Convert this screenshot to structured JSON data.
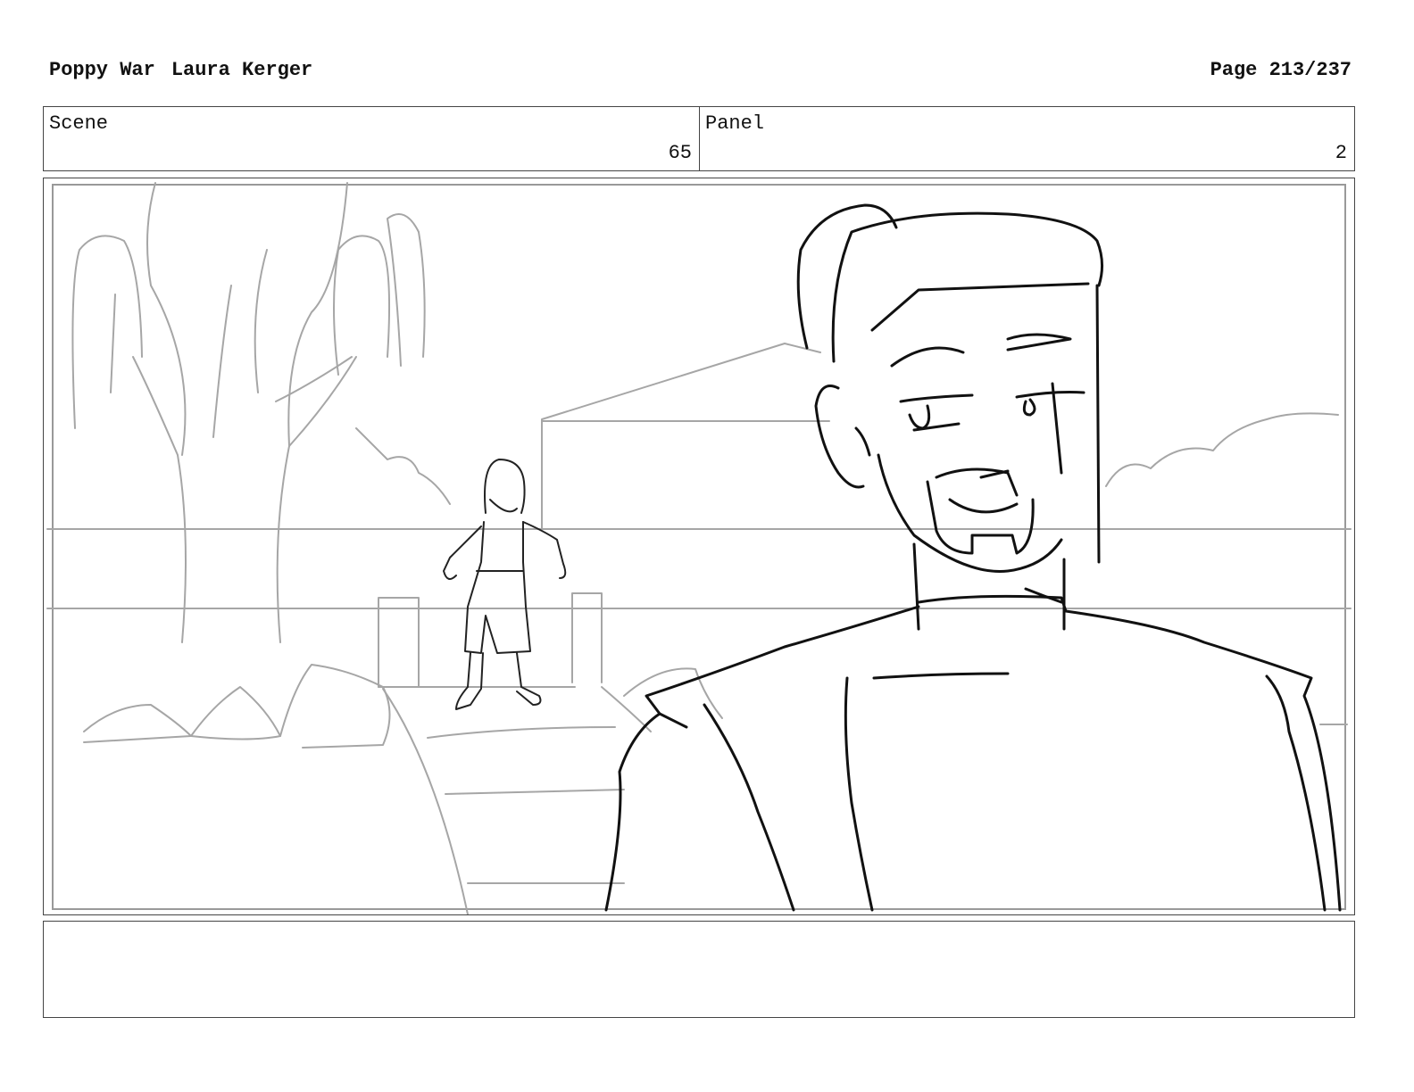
{
  "header": {
    "title": "Poppy War",
    "author": "Laura Kerger",
    "page": "Page 213/237"
  },
  "meta": {
    "scene_label": "Scene",
    "scene_value": "65",
    "panel_label": "Panel",
    "panel_value": "2"
  },
  "notes": {
    "text": ""
  }
}
